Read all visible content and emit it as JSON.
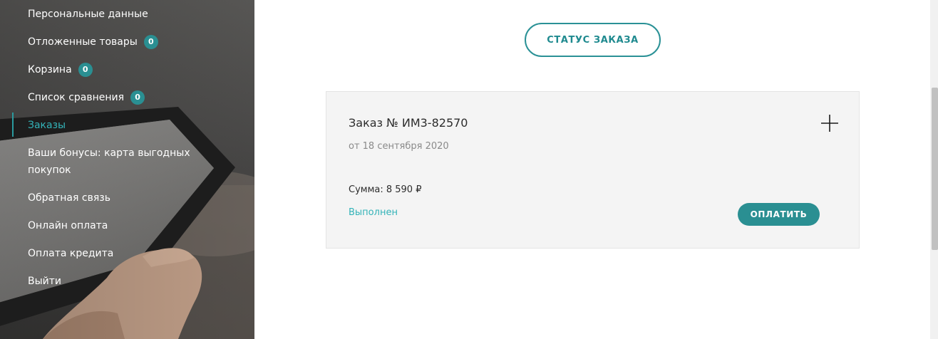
{
  "sidebar": {
    "items": [
      {
        "label": "Персональные данные"
      },
      {
        "label": "Отложенные товары",
        "badge": "0"
      },
      {
        "label": "Корзина",
        "badge": "0"
      },
      {
        "label": "Список сравнения",
        "badge": "0"
      },
      {
        "label": "Заказы",
        "active": true
      },
      {
        "label": "Ваши бонусы: карта выгодных покупок"
      },
      {
        "label": "Обратная связь"
      },
      {
        "label": "Онлайн оплата"
      },
      {
        "label": "Оплата кредита"
      },
      {
        "label": "Выйти"
      }
    ],
    "active_color": "#33b3b8",
    "badge_color": "#2a8f92"
  },
  "main": {
    "status_button_label": "СТАТУС ЗАКАЗА",
    "order": {
      "title": "Заказ № ИМ3-82570",
      "date": "от 18 сентября 2020",
      "sum": "Сумма: 8 590 ₽",
      "status": "Выполнен",
      "pay_button_label": "ОПЛАТИТЬ",
      "expand_icon": "plus-icon"
    },
    "accent_color": "#2a8f92"
  }
}
